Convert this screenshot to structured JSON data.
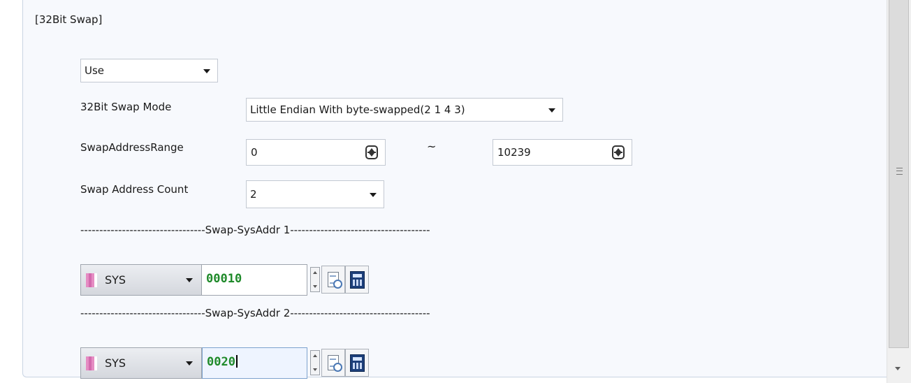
{
  "section": {
    "title": "[32Bit Swap]"
  },
  "use_select": {
    "value": "Use"
  },
  "swap_mode": {
    "label": "32Bit Swap Mode",
    "value": "Little Endian With byte-swapped(2 1 4 3)"
  },
  "address_range": {
    "label": "SwapAddressRange",
    "start": "0",
    "separator": "~",
    "end": "10239"
  },
  "address_count": {
    "label": "Swap Address Count",
    "value": "2"
  },
  "sysaddr_rows": [
    {
      "divider": "---------------------------------Swap-SysAddr 1-------------------------------------",
      "device": "SYS",
      "address": "00010"
    },
    {
      "divider": "---------------------------------Swap-SysAddr 2-------------------------------------",
      "device": "SYS",
      "address": "0020"
    }
  ],
  "colors": {
    "address_text": "#1f8a2a",
    "panel_bg": "#f7f9fd",
    "device_marker": "#e58cc3"
  }
}
